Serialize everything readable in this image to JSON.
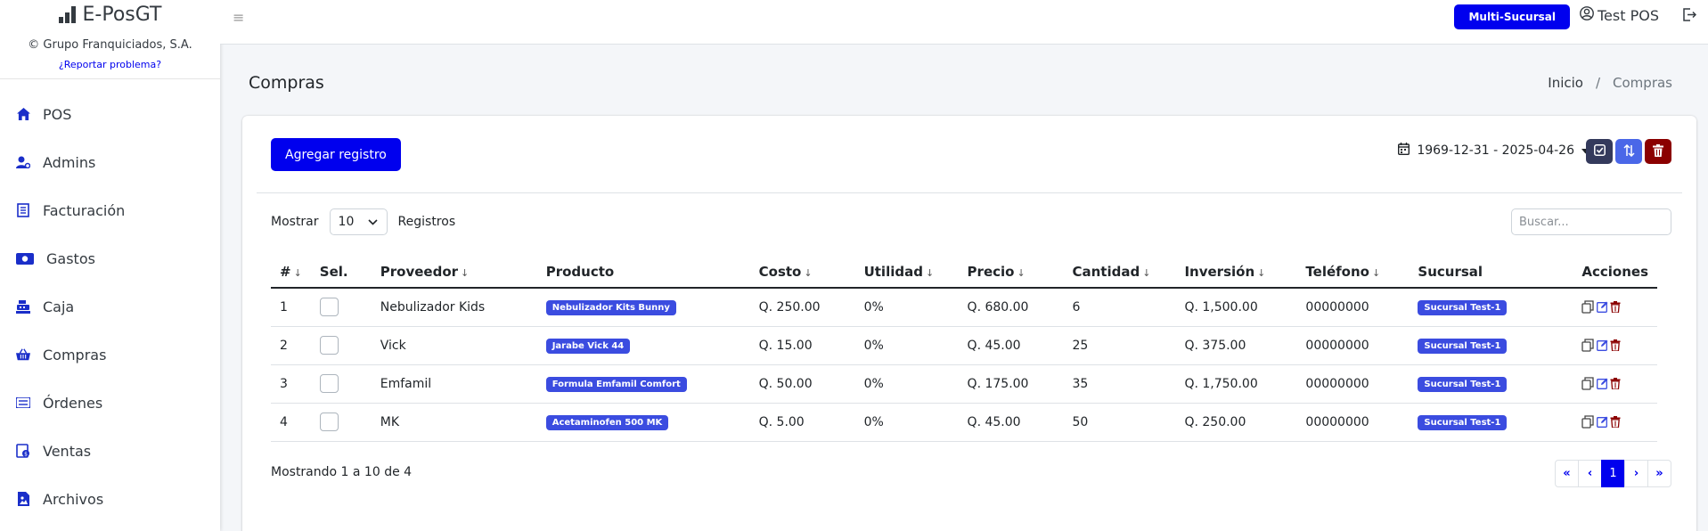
{
  "brand": {
    "name": "E-PosGT",
    "copyright": "© Grupo Franquiciados, S.A.",
    "report_link": "¿Reportar problema?"
  },
  "sidebar": {
    "items": [
      {
        "label": "POS",
        "icon": "home-icon"
      },
      {
        "label": "Admins",
        "icon": "user-gear-icon"
      },
      {
        "label": "Facturación",
        "icon": "invoice-icon"
      },
      {
        "label": "Gastos",
        "icon": "money-icon"
      },
      {
        "label": "Caja",
        "icon": "cash-register-icon"
      },
      {
        "label": "Compras",
        "icon": "basket-icon"
      },
      {
        "label": "Órdenes",
        "icon": "list-icon"
      },
      {
        "label": "Ventas",
        "icon": "sales-icon"
      },
      {
        "label": "Archivos",
        "icon": "file-image-icon"
      }
    ]
  },
  "topbar": {
    "multi_sucursal": "Multi-Sucursal",
    "user_name": "Test POS"
  },
  "page": {
    "title": "Compras",
    "breadcrumb_home": "Inicio",
    "breadcrumb_sep": "/",
    "breadcrumb_current": "Compras"
  },
  "toolbar": {
    "add_label": "Agregar registro",
    "date_range": "1969-12-31 - 2025-04-26"
  },
  "list_controls": {
    "show_label": "Mostrar",
    "page_size": "10",
    "records_label": "Registros",
    "search_placeholder": "Buscar..."
  },
  "table": {
    "headers": [
      "#",
      "Sel.",
      "Proveedor",
      "Producto",
      "Costo",
      "Utilidad",
      "Precio",
      "Cantidad",
      "Inversión",
      "Teléfono",
      "Sucursal",
      "Acciones"
    ],
    "rows": [
      {
        "num": "1",
        "proveedor": "Nebulizador Kids",
        "producto": "Nebulizador Kits Bunny",
        "costo": "Q. 250.00",
        "utilidad": "0%",
        "precio": "Q. 680.00",
        "cantidad": "6",
        "inversion": "Q. 1,500.00",
        "telefono": "00000000",
        "sucursal": "Sucursal Test-1"
      },
      {
        "num": "2",
        "proveedor": "Vick",
        "producto": "Jarabe Vick 44",
        "costo": "Q. 15.00",
        "utilidad": "0%",
        "precio": "Q. 45.00",
        "cantidad": "25",
        "inversion": "Q. 375.00",
        "telefono": "00000000",
        "sucursal": "Sucursal Test-1"
      },
      {
        "num": "3",
        "proveedor": "Emfamil",
        "producto": "Formula Emfamil Comfort",
        "costo": "Q. 50.00",
        "utilidad": "0%",
        "precio": "Q. 175.00",
        "cantidad": "35",
        "inversion": "Q. 1,750.00",
        "telefono": "00000000",
        "sucursal": "Sucursal Test-1"
      },
      {
        "num": "4",
        "proveedor": "MK",
        "producto": "Acetaminofen 500 MK",
        "costo": "Q. 5.00",
        "utilidad": "0%",
        "precio": "Q. 45.00",
        "cantidad": "50",
        "inversion": "Q. 250.00",
        "telefono": "00000000",
        "sucursal": "Sucursal Test-1"
      }
    ]
  },
  "footer": {
    "info": "Mostrando 1 a 10 de 4",
    "pager": {
      "first": "«",
      "prev": "‹",
      "current": "1",
      "next": "›",
      "last": "»"
    }
  },
  "colors": {
    "primary": "#0000ee",
    "badge": "#3b4ce0",
    "btn_dark": "#343a5c",
    "btn_swap": "#4a67e8",
    "btn_delete": "#8b0000"
  }
}
